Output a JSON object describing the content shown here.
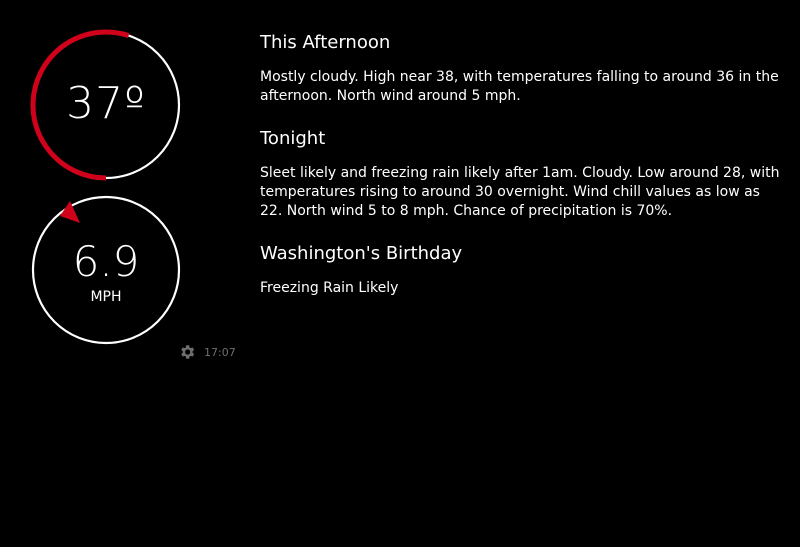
{
  "current": {
    "temperature": "37º",
    "temperature_ring_fraction": 0.55,
    "wind_speed": "6.9",
    "wind_unit": "MPH",
    "wind_direction": "north"
  },
  "status": {
    "settings_icon": "gear-icon",
    "time": "17:07"
  },
  "forecast": {
    "periods": [
      {
        "name": "This Afternoon",
        "text": "Mostly cloudy. High near 38, with temperatures falling to around 36 in the afternoon. North wind around 5 mph."
      },
      {
        "name": "Tonight",
        "text": "Sleet likely and freezing rain likely after 1am. Cloudy. Low around 28, with temperatures rising to around 30 overnight. Wind chill values as low as 22. North wind 5 to 8 mph. Chance of precipitation is 70%."
      },
      {
        "name": "Washington's Birthday",
        "text": "Freezing Rain Likely"
      }
    ]
  },
  "colors": {
    "accent": "#d0021b",
    "ring": "#ffffff",
    "background": "#000000",
    "muted": "#6e6e6e"
  }
}
